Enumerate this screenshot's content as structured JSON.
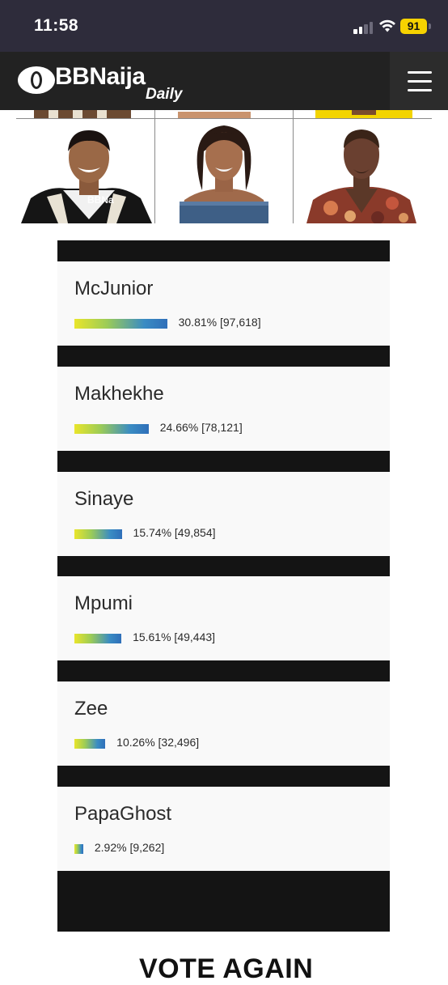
{
  "status_bar": {
    "time": "11:58",
    "battery": "91",
    "icons": [
      "cellular-signal-icon",
      "wifi-icon",
      "battery-icon"
    ]
  },
  "header": {
    "logo_main": "BBNaija",
    "logo_sub": "Daily",
    "menu_icon": "hamburger-menu-icon"
  },
  "gallery": {
    "watermark": "BBNa"
  },
  "poll": {
    "options": [
      {
        "name": "McJunior",
        "percent": 30.81,
        "label": "30.81% [97,618]"
      },
      {
        "name": "Makhekhe",
        "percent": 24.66,
        "label": "24.66% [78,121]"
      },
      {
        "name": "Sinaye",
        "percent": 15.74,
        "label": "15.74% [49,854]"
      },
      {
        "name": "Mpumi",
        "percent": 15.61,
        "label": "15.61% [49,443]"
      },
      {
        "name": "Zee",
        "percent": 10.26,
        "label": "10.26% [32,496]"
      },
      {
        "name": "PapaGhost",
        "percent": 2.92,
        "label": "2.92% [9,262]"
      }
    ]
  },
  "footer": {
    "vote_again": "VOTE AGAIN"
  }
}
